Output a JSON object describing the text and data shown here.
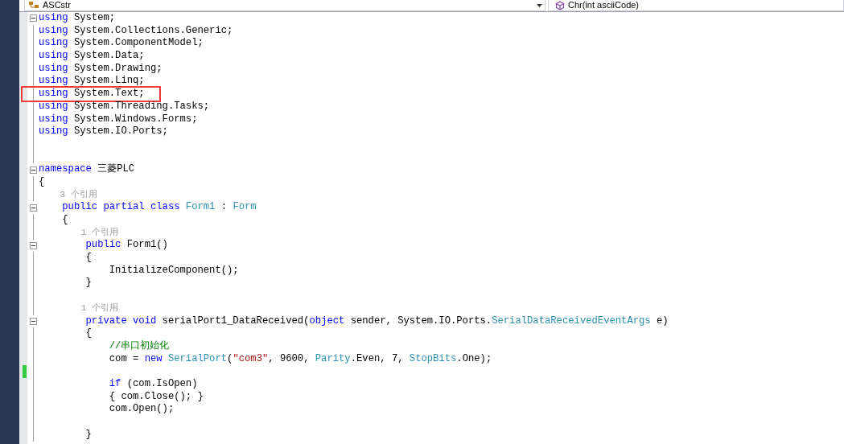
{
  "navigation_bar": {
    "type_dropdown": {
      "value": "ASCstr"
    },
    "member_dropdown": {
      "value": "Chr(int asciiCode)"
    }
  },
  "code_lines": [
    {
      "foldable": true,
      "tokens": [
        {
          "kind": "keyword",
          "text": "using"
        },
        {
          "kind": "plain",
          "text": " System;"
        }
      ]
    },
    {
      "tokens": [
        {
          "kind": "keyword",
          "text": "using"
        },
        {
          "kind": "plain",
          "text": " System.Collections.Generic;"
        }
      ]
    },
    {
      "tokens": [
        {
          "kind": "keyword",
          "text": "using"
        },
        {
          "kind": "plain",
          "text": " System.ComponentModel;"
        }
      ]
    },
    {
      "tokens": [
        {
          "kind": "keyword",
          "text": "using"
        },
        {
          "kind": "plain",
          "text": " System.Data;"
        }
      ]
    },
    {
      "tokens": [
        {
          "kind": "keyword",
          "text": "using"
        },
        {
          "kind": "plain",
          "text": " System.Drawing;"
        }
      ]
    },
    {
      "tokens": [
        {
          "kind": "keyword",
          "text": "using"
        },
        {
          "kind": "plain",
          "text": " System.Linq;"
        }
      ]
    },
    {
      "highlighted": true,
      "tokens": [
        {
          "kind": "keyword",
          "text": "using"
        },
        {
          "kind": "plain",
          "text": " System.Text;"
        }
      ]
    },
    {
      "tokens": [
        {
          "kind": "keyword",
          "text": "using"
        },
        {
          "kind": "plain",
          "text": " System.Threading.Tasks;"
        }
      ]
    },
    {
      "tokens": [
        {
          "kind": "keyword",
          "text": "using"
        },
        {
          "kind": "plain",
          "text": " System.Windows.Forms;"
        }
      ]
    },
    {
      "tokens": [
        {
          "kind": "keyword",
          "text": "using"
        },
        {
          "kind": "plain",
          "text": " System.IO.Ports;"
        }
      ]
    },
    {
      "kind": "blank"
    },
    {
      "kind": "blank"
    },
    {
      "foldable": true,
      "tokens": [
        {
          "kind": "keyword",
          "text": "namespace"
        },
        {
          "kind": "plain",
          "text": " 三菱PLC"
        }
      ]
    },
    {
      "tokens": [
        {
          "kind": "plain",
          "text": "{"
        }
      ]
    },
    {
      "tokens": [
        {
          "kind": "codelens",
          "text": "    3 个引用"
        }
      ]
    },
    {
      "foldable": true,
      "tokens": [
        {
          "kind": "keyword",
          "text": "    public partial class"
        },
        {
          "kind": "type",
          "text": " Form1"
        },
        {
          "kind": "plain",
          "text": " : "
        },
        {
          "kind": "type",
          "text": "Form"
        }
      ]
    },
    {
      "tokens": [
        {
          "kind": "plain",
          "text": "    {"
        }
      ]
    },
    {
      "tokens": [
        {
          "kind": "codelens",
          "text": "        1 个引用"
        }
      ]
    },
    {
      "foldable": true,
      "tokens": [
        {
          "kind": "keyword",
          "text": "        public"
        },
        {
          "kind": "plain",
          "text": " Form1()"
        }
      ]
    },
    {
      "tokens": [
        {
          "kind": "plain",
          "text": "        {"
        }
      ]
    },
    {
      "tokens": [
        {
          "kind": "plain",
          "text": "            InitializeComponent();"
        }
      ]
    },
    {
      "tokens": [
        {
          "kind": "plain",
          "text": "        }"
        }
      ]
    },
    {
      "kind": "blank"
    },
    {
      "tokens": [
        {
          "kind": "codelens",
          "text": "        1 个引用"
        }
      ]
    },
    {
      "foldable": true,
      "tokens": [
        {
          "kind": "keyword",
          "text": "        private void"
        },
        {
          "kind": "plain",
          "text": " serialPort1_DataReceived("
        },
        {
          "kind": "keyword",
          "text": "object"
        },
        {
          "kind": "plain",
          "text": " sender, System.IO.Ports."
        },
        {
          "kind": "type",
          "text": "SerialDataReceivedEventArgs"
        },
        {
          "kind": "plain",
          "text": " e)"
        }
      ]
    },
    {
      "tokens": [
        {
          "kind": "plain",
          "text": "        {"
        }
      ]
    },
    {
      "tokens": [
        {
          "kind": "comment",
          "text": "            //串口初始化"
        }
      ]
    },
    {
      "tokens": [
        {
          "kind": "plain",
          "text": "            com = "
        },
        {
          "kind": "keyword",
          "text": "new"
        },
        {
          "kind": "type",
          "text": " SerialPort"
        },
        {
          "kind": "plain",
          "text": "("
        },
        {
          "kind": "string",
          "text": "\"com3\""
        },
        {
          "kind": "plain",
          "text": ", 9600, "
        },
        {
          "kind": "type",
          "text": "Parity"
        },
        {
          "kind": "plain",
          "text": ".Even, 7, "
        },
        {
          "kind": "type",
          "text": "StopBits"
        },
        {
          "kind": "plain",
          "text": ".One);"
        }
      ]
    },
    {
      "kind": "blank",
      "changed": true
    },
    {
      "tokens": [
        {
          "kind": "keyword",
          "text": "            if"
        },
        {
          "kind": "plain",
          "text": " (com.IsOpen)"
        }
      ]
    },
    {
      "tokens": [
        {
          "kind": "plain",
          "text": "            { com.Close(); }"
        }
      ]
    },
    {
      "tokens": [
        {
          "kind": "plain",
          "text": "            com.Open();"
        }
      ]
    },
    {
      "kind": "blank"
    },
    {
      "tokens": [
        {
          "kind": "plain",
          "text": "        }"
        }
      ]
    }
  ]
}
